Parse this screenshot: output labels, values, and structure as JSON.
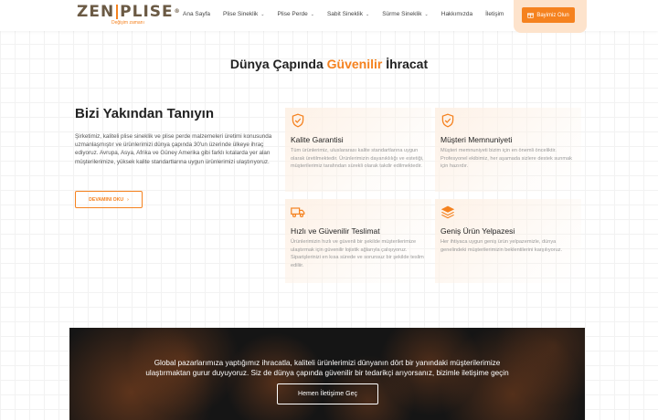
{
  "header": {
    "logo": {
      "left": "ZEN",
      "right": "PLISE",
      "tagline": "Değişim zamanı"
    },
    "nav": [
      {
        "label": "Ana Sayfa",
        "dropdown": false
      },
      {
        "label": "Plise Sineklik",
        "dropdown": true
      },
      {
        "label": "Plise Perde",
        "dropdown": true
      },
      {
        "label": "Sabit Sineklik",
        "dropdown": true
      },
      {
        "label": "Sürme Sineklik",
        "dropdown": true
      },
      {
        "label": "Hakkımızda",
        "dropdown": false
      },
      {
        "label": "İletişim",
        "dropdown": false
      }
    ],
    "cta_label": "Bayimiz Olun"
  },
  "section": {
    "title_before": "Dünya Çapında ",
    "title_accent": "Güvenilir",
    "title_after": " İhracat"
  },
  "about": {
    "title": "Bizi Yakından Tanıyın",
    "text": "Şirketimiz, kaliteli plise sineklik ve plise perde malzemeleri üretimi konusunda uzmanlaşmıştır ve ürünlerimizi dünya çapında 30'un üzerinde ülkeye ihraç ediyoruz. Avrupa, Asya, Afrika ve Güney Amerika gibi farklı kıtalarda yer alan müşterilerimize, yüksek kalite standartlarına uygun ürünlerimizi ulaştırıyoruz.",
    "button_label": "DEVAMINI OKU"
  },
  "features": [
    {
      "icon": "shield-check-icon",
      "title": "Kalite Garantisi",
      "text": "Tüm ürünlerimiz, uluslararası kalite standartlarına uygun olarak üretilmektedir. Ürünlerimizin dayanıklılığı ve estetiği, müşterilerimiz tarafından sürekli olarak takdir edilmektedir."
    },
    {
      "icon": "shield-check-icon",
      "title": "Müşteri Memnuniyeti",
      "text": "Müşteri memnuniyeti bizim için en önemli önceliktir. Profesyonel ekibimiz, her aşamada sizlere destek sunmak için hazırdır."
    },
    {
      "icon": "truck-icon",
      "title": "Hızlı ve Güvenilir Teslimat",
      "text": "Ürünlerimizin hızlı ve güvenli bir şekilde müşterilerimize ulaştırmak için güvenilir lojistik ağlarıyla çalışıyoruz. Siparişlerinizi en kısa sürede ve sorunsuz bir şekilde teslim ediliir."
    },
    {
      "icon": "layers-icon",
      "title": "Geniş Ürün Yelpazesi",
      "text": "Her ihtiyaca uygun geniş ürün yelpazemizle, dünya genelindeki müşterilerimizin beklentilerini karşılıyoruz."
    }
  ],
  "banner": {
    "line1": "Global pazarlarımıza yaptığımız ihracatla, kaliteli ürünlerimizi dünyanın dört bir yanındaki müşterilerimize",
    "line2": "ulaştırmaktan gurur duyuyoruz. Siz de dünya çapında güvenilir bir tedarikçi arıyorsanız, bizimle iletişime geçin",
    "button_label": "Hemen İletişime Geç"
  },
  "colors": {
    "accent": "#f5821f",
    "logo": "#6b5a44",
    "banner_bg": "#151515"
  }
}
